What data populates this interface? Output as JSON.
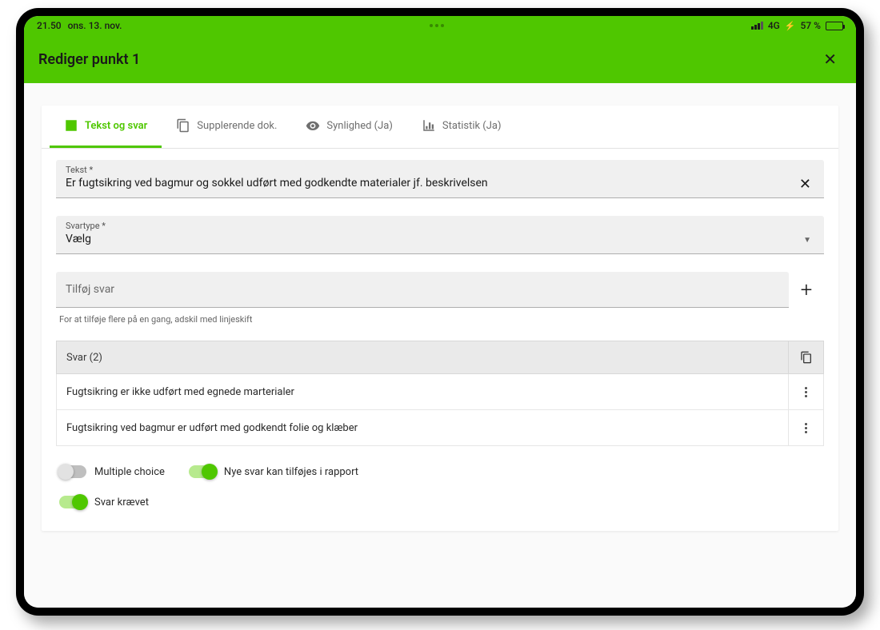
{
  "status": {
    "time": "21.50",
    "date": "ons. 13. nov.",
    "network": "4G",
    "battery_pct": "57 %"
  },
  "title": "Rediger punkt 1",
  "tabs": {
    "text_answers": "Tekst og svar",
    "supplementary": "Supplerende dok.",
    "visibility": "Synlighed (Ja)",
    "statistics": "Statistik (Ja)"
  },
  "fields": {
    "text_label": "Tekst *",
    "text_value": "Er fugtsikring ved bagmur og sokkel udført med godkendte materialer jf. beskrivelsen",
    "answer_type_label": "Svartype *",
    "answer_type_value": "Vælg",
    "add_answer_placeholder": "Tilføj svar",
    "add_answer_helper": "For at tilføje flere på en gang, adskil med linjeskift"
  },
  "answers": {
    "header": "Svar (2)",
    "items": [
      "Fugtsikring er ikke udført med egnede marterialer",
      "Fugtsikring ved bagmur er udført med godkendt folie og klæber"
    ]
  },
  "toggles": {
    "multiple_choice": {
      "label": "Multiple choice",
      "on": false
    },
    "new_answers": {
      "label": "Nye svar kan tilføjes i rapport",
      "on": true
    },
    "answer_required": {
      "label": "Svar krævet",
      "on": true
    }
  }
}
